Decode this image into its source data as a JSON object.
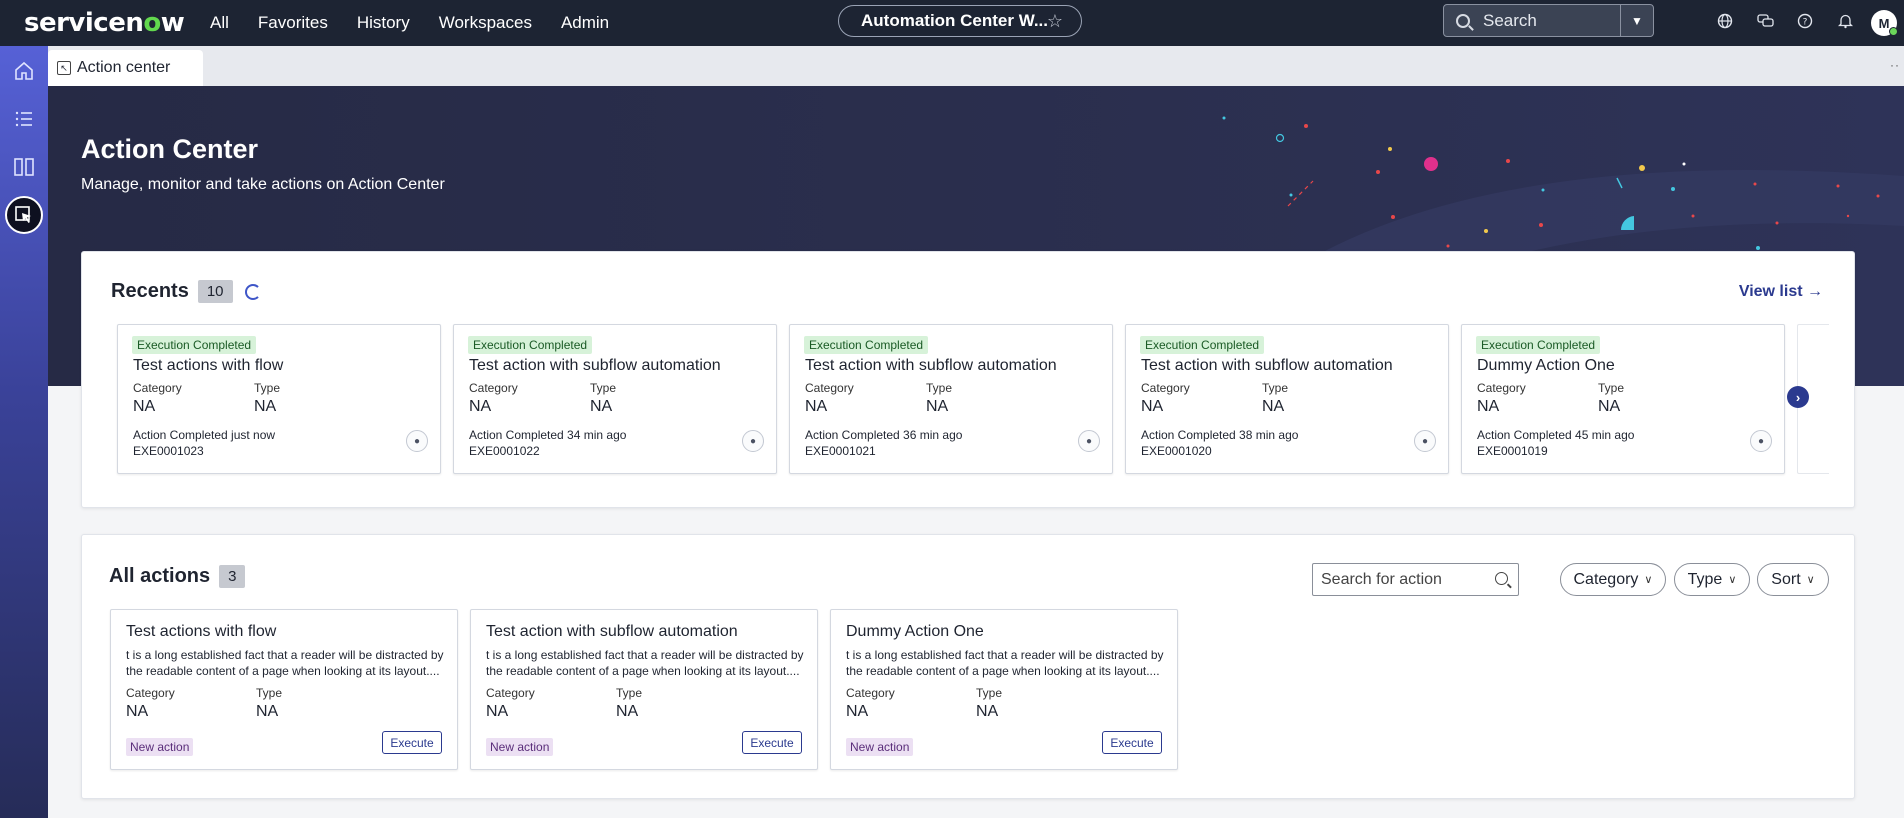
{
  "topbar": {
    "logo_pre": "servicen",
    "logo_o": "o",
    "logo_post": "w",
    "nav": [
      "All",
      "Favorites",
      "History",
      "Workspaces",
      "Admin"
    ],
    "center_title": "Automation Center W...",
    "search_placeholder": "Search",
    "avatar_initial": "M"
  },
  "tabs": [
    {
      "label": "Action center"
    }
  ],
  "hero": {
    "title": "Action Center",
    "subtitle": "Manage, monitor and take actions on Action Center"
  },
  "recents": {
    "title": "Recents",
    "count": "10",
    "view_list": "View list",
    "cards": [
      {
        "status": "Execution Completed",
        "title": "Test actions with flow",
        "category_label": "Category",
        "category": "NA",
        "type_label": "Type",
        "type": "NA",
        "completed": "Action Completed just now",
        "id": "EXE0001023"
      },
      {
        "status": "Execution Completed",
        "title": "Test action with subflow automation",
        "category_label": "Category",
        "category": "NA",
        "type_label": "Type",
        "type": "NA",
        "completed": "Action Completed 34 min ago",
        "id": "EXE0001022"
      },
      {
        "status": "Execution Completed",
        "title": "Test action with subflow automation",
        "category_label": "Category",
        "category": "NA",
        "type_label": "Type",
        "type": "NA",
        "completed": "Action Completed 36 min ago",
        "id": "EXE0001021"
      },
      {
        "status": "Execution Completed",
        "title": "Test action with subflow automation",
        "category_label": "Category",
        "category": "NA",
        "type_label": "Type",
        "type": "NA",
        "completed": "Action Completed 38 min ago",
        "id": "EXE0001020"
      },
      {
        "status": "Execution Completed",
        "title": "Dummy Action One",
        "category_label": "Category",
        "category": "NA",
        "type_label": "Type",
        "type": "NA",
        "completed": "Action Completed 45 min ago",
        "id": "EXE0001019"
      }
    ]
  },
  "all_actions": {
    "title": "All actions",
    "count": "3",
    "search_placeholder": "Search for action",
    "filters": {
      "category": "Category",
      "type": "Type",
      "sort": "Sort"
    },
    "cards": [
      {
        "title": "Test actions with flow",
        "desc": "t is a long established fact that a reader will be distracted by the readable content of a page when looking at its layout....",
        "category_label": "Category",
        "category": "NA",
        "type_label": "Type",
        "type": "NA",
        "badge": "New action",
        "execute": "Execute"
      },
      {
        "title": "Test action with subflow automation",
        "desc": "t is a long established fact that a reader will be distracted by the readable content of a page when looking at its layout....",
        "category_label": "Category",
        "category": "NA",
        "type_label": "Type",
        "type": "NA",
        "badge": "New action",
        "execute": "Execute"
      },
      {
        "title": "Dummy Action One",
        "desc": "t is a long established fact that a reader will be distracted by the readable content of a page when looking at its layout....",
        "category_label": "Category",
        "category": "NA",
        "type_label": "Type",
        "type": "NA",
        "badge": "New action",
        "execute": "Execute"
      }
    ]
  },
  "icons": {
    "rail": [
      "home-icon",
      "list-icon",
      "columns-icon",
      "action-center-icon"
    ],
    "top": [
      "globe-icon",
      "chat-icon",
      "help-icon",
      "bell-icon"
    ]
  },
  "colors": {
    "accent": "#2b3a8f",
    "topbar": "#1d2433",
    "completed_badge": "#d7f2d9",
    "new_badge": "#ece0f3"
  }
}
